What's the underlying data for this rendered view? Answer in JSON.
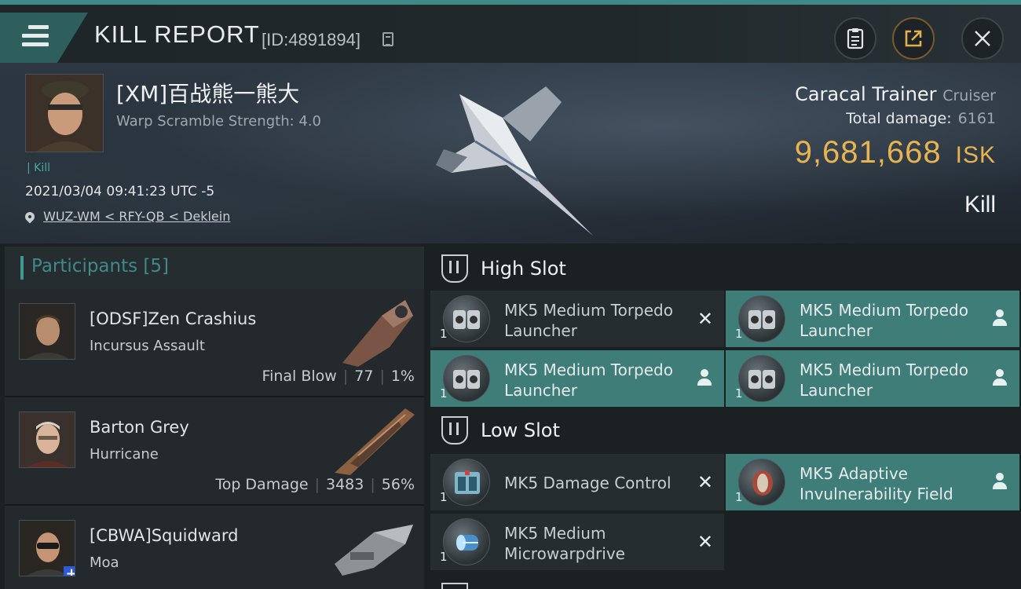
{
  "header": {
    "title": "KILL REPORT",
    "report_id": "[ID:4891894]",
    "icons": [
      "menu-icon",
      "copy-icon",
      "clipboard-icon",
      "share-icon",
      "close-icon"
    ]
  },
  "victim": {
    "name": "[XM]百战熊一熊大",
    "subtitle": "Warp Scramble Strength: 4.0",
    "tag": "Kill",
    "datetime": "2021/03/04 09:41:23 UTC -5",
    "location": "WUZ-WM < RFY-QB < Deklein"
  },
  "ship": {
    "name": "Caracal Trainer",
    "class": "Cruiser",
    "damage_label": "Total damage:",
    "damage_value": "6161",
    "isk_value": "9,681,668",
    "isk_unit": "ISK",
    "kind": "Kill"
  },
  "participants": {
    "title": "Participants",
    "count": "[5]",
    "rows": [
      {
        "name": "[ODSF]Zen Crashius",
        "ship": "Incursus Assault",
        "role": "Final Blow",
        "damage": "77",
        "percent": "1%"
      },
      {
        "name": "Barton Grey",
        "ship": "Hurricane",
        "role": "Top Damage",
        "damage": "3483",
        "percent": "56%"
      },
      {
        "name": "[CBWA]Squidward",
        "ship": "Moa",
        "role": "",
        "damage": "",
        "percent": ""
      }
    ]
  },
  "slots": {
    "high": {
      "title": "High Slot",
      "modules": [
        {
          "line1": "MK5 Medium Torpedo",
          "line2": "Launcher",
          "qty": "1",
          "state": "destroyed"
        },
        {
          "line1": "MK5 Medium Torpedo",
          "line2": "Launcher",
          "qty": "1",
          "state": "dropped"
        },
        {
          "line1": "MK5 Medium Torpedo",
          "line2": "Launcher",
          "qty": "1",
          "state": "dropped"
        },
        {
          "line1": "MK5 Medium Torpedo",
          "line2": "Launcher",
          "qty": "1",
          "state": "dropped"
        }
      ]
    },
    "low": {
      "title": "Low Slot",
      "modules": [
        {
          "line1": "MK5 Damage Control",
          "line2": "",
          "qty": "1",
          "state": "destroyed"
        },
        {
          "line1": "MK5 Adaptive",
          "line2": "Invulnerability Field",
          "qty": "1",
          "state": "dropped"
        },
        {
          "line1": "MK5 Medium",
          "line2": "Microwarpdrive",
          "qty": "1",
          "state": "destroyed"
        }
      ]
    }
  },
  "colors": {
    "accent_teal": "#3f8a86",
    "dropped_bg": "#3f7d78",
    "isk_gold": "#e8b452"
  }
}
